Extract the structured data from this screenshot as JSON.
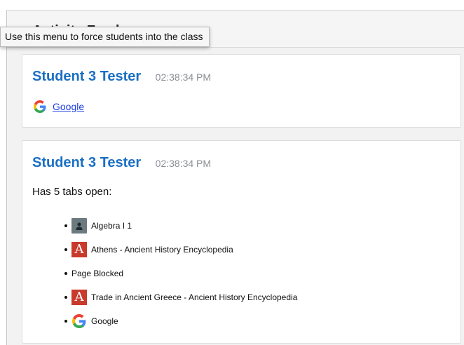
{
  "tooltip": "Use this menu to force students into the class",
  "panel": {
    "heading": "Activity Feed"
  },
  "feed": [
    {
      "student": "Student 3 Tester",
      "time": "02:38:34 PM",
      "site": {
        "icon": "google-icon",
        "label": "Google"
      }
    },
    {
      "student": "Student 3 Tester",
      "time": "02:38:34 PM",
      "summary": "Has 5 tabs open:",
      "tabs": [
        {
          "icon": "classroom-icon",
          "label": "Algebra I 1"
        },
        {
          "icon": "ancient-history-icon",
          "label": "Athens - Ancient History Encyclopedia"
        },
        {
          "icon": "none",
          "label": "Page Blocked"
        },
        {
          "icon": "ancient-history-icon",
          "label": "Trade in Ancient Greece - Ancient History Encyclopedia"
        },
        {
          "icon": "google-icon",
          "label": "Google"
        }
      ]
    }
  ],
  "colors": {
    "student_name": "#1a6fc4",
    "timestamp": "#8b8f95",
    "link": "#1b3ee0",
    "ancient_history_icon": "#c83a2b"
  }
}
